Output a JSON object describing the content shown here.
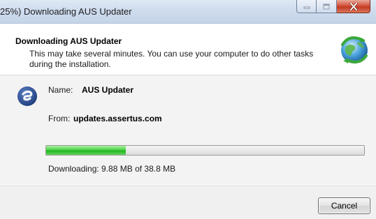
{
  "window": {
    "title": "25%) Downloading AUS Updater"
  },
  "header": {
    "title": "Downloading AUS Updater",
    "description": "This may take several minutes. You can use your computer to do other tasks during the installation."
  },
  "details": {
    "name_label": "Name:",
    "name_value": "AUS Updater",
    "from_label": "From:",
    "from_value": "updates.assertus.com"
  },
  "progress": {
    "fraction": 0.25,
    "status": "Downloading: 9.88 MB of 38.8 MB"
  },
  "footer": {
    "cancel_label": "Cancel"
  },
  "icons": {
    "minimize": "minimize-icon",
    "maximize": "maximize-icon",
    "close": "close-icon",
    "header": "globe-sync-icon",
    "app": "app-logo-icon"
  },
  "colors": {
    "progress_fill": "#2fc02b",
    "close_button": "#c7432b"
  }
}
